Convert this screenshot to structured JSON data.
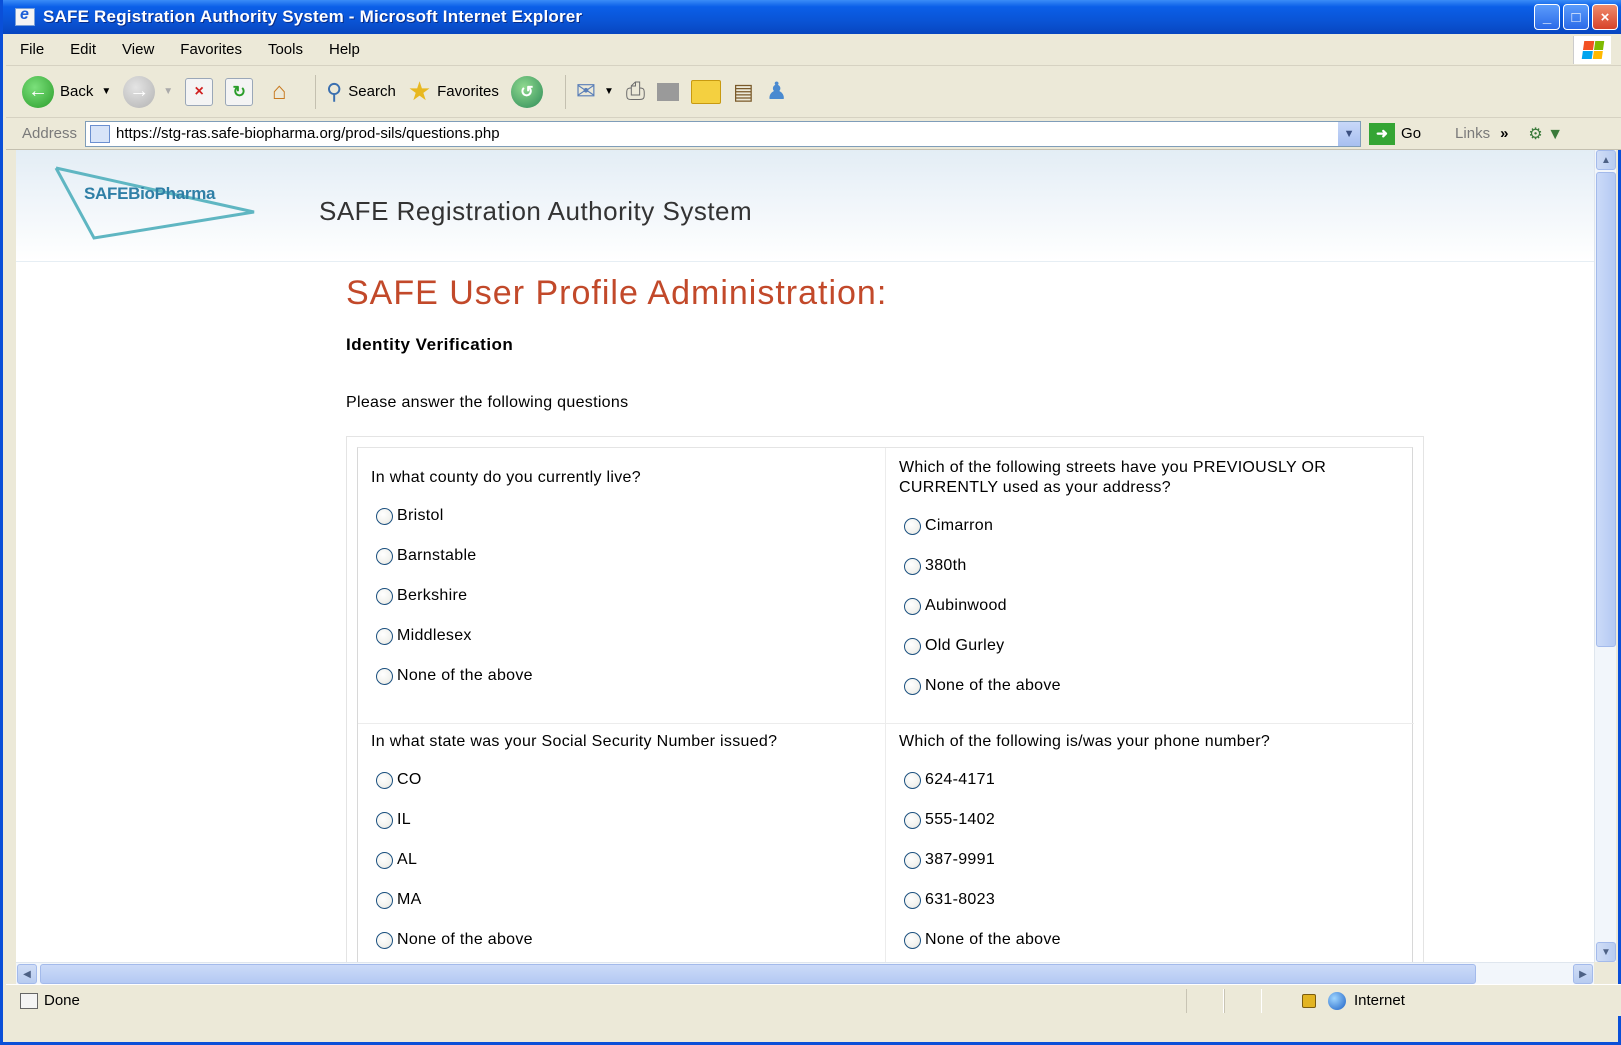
{
  "window": {
    "title": "SAFE Registration Authority System - Microsoft Internet Explorer"
  },
  "menu": [
    "File",
    "Edit",
    "View",
    "Favorites",
    "Tools",
    "Help"
  ],
  "toolbar": {
    "back_label": "Back",
    "search_label": "Search",
    "favorites_label": "Favorites"
  },
  "address": {
    "label": "Address",
    "url": "https://stg-ras.safe-biopharma.org/prod-sils/questions.php",
    "go_label": "Go",
    "links_label": "Links"
  },
  "site": {
    "logo_text": "SAFEBioPharma",
    "title": "SAFE Registration Authority System"
  },
  "page": {
    "heading": "SAFE User Profile Administration:",
    "subheading": "Identity Verification",
    "instructions": "Please answer the following questions"
  },
  "questions": [
    {
      "text": "In what county do you currently live?",
      "options": [
        "Bristol",
        "Barnstable",
        "Berkshire",
        "Middlesex",
        "None of the above"
      ]
    },
    {
      "text": "Which of the following streets have you PREVIOUSLY OR CURRENTLY used as your address?",
      "options": [
        "Cimarron",
        "380th",
        "Aubinwood",
        "Old Gurley",
        "None of the above"
      ]
    },
    {
      "text": "In what state was your Social Security Number issued?",
      "options": [
        "CO",
        "IL",
        "AL",
        "MA",
        "None of the above"
      ]
    },
    {
      "text": "Which of the following is/was your phone number?",
      "options": [
        "624-4171",
        "555-1402",
        "387-9991",
        "631-8023",
        "None of the above"
      ]
    }
  ],
  "status": {
    "text": "Done",
    "zone": "Internet"
  },
  "colors": {
    "heading": "#c2492a",
    "logo": "#2f7fa6",
    "titlebar": "#0a54d6"
  }
}
